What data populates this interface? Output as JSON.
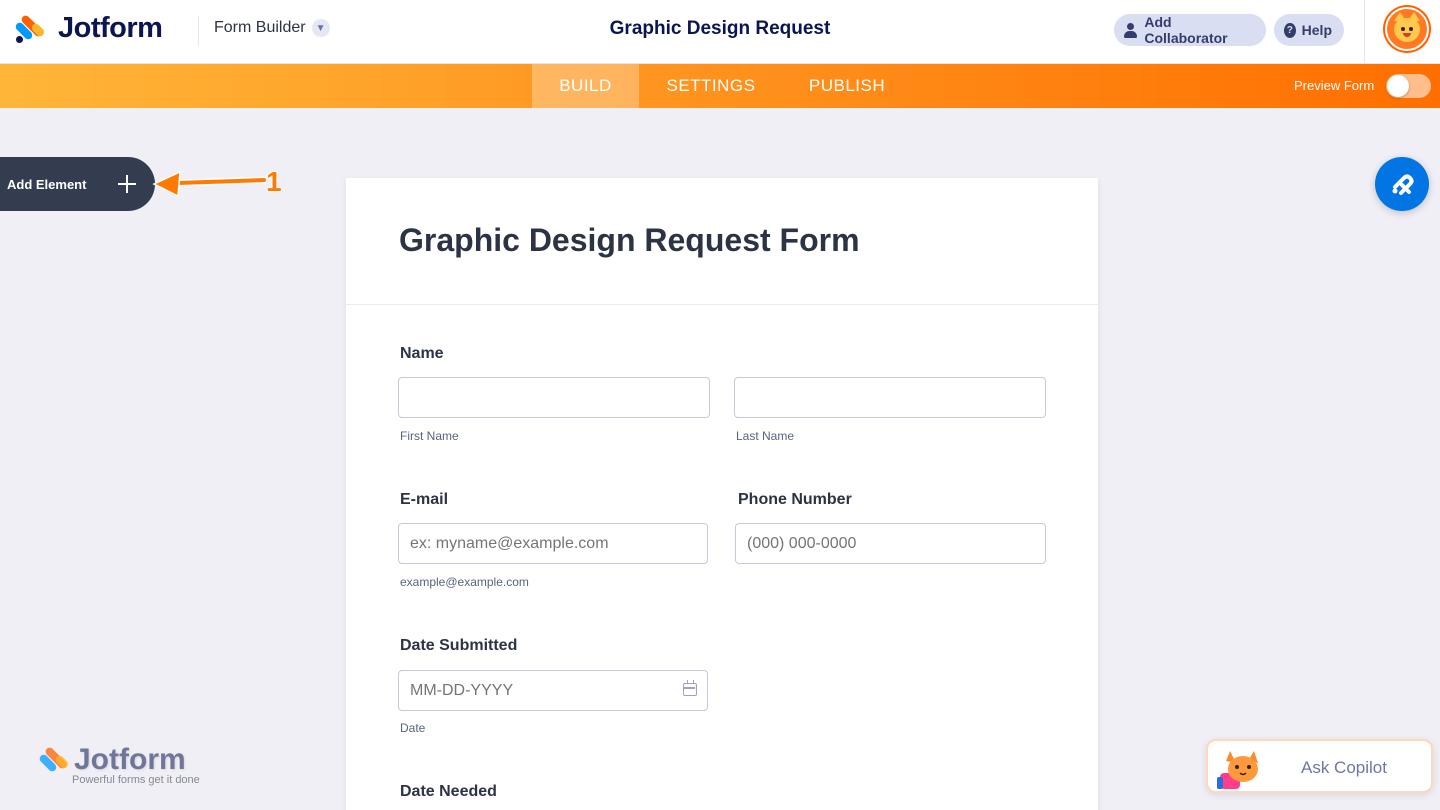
{
  "header": {
    "brand": "Jotform",
    "builder_menu": "Form Builder",
    "form_title": "Graphic Design Request",
    "add_collaborator": "Add Collaborator",
    "help": "Help"
  },
  "nav": {
    "tabs": [
      "BUILD",
      "SETTINGS",
      "PUBLISH"
    ],
    "active_tab": "BUILD",
    "preview_label": "Preview Form",
    "preview_on": false
  },
  "sidebar": {
    "add_element": "Add Element"
  },
  "annotation": {
    "number": "1"
  },
  "form": {
    "heading": "Graphic Design Request Form",
    "name": {
      "label": "Name",
      "first_sublabel": "First Name",
      "last_sublabel": "Last Name"
    },
    "email": {
      "label": "E-mail",
      "placeholder": "ex: myname@example.com",
      "sublabel": "example@example.com"
    },
    "phone": {
      "label": "Phone Number",
      "placeholder": "(000) 000-0000"
    },
    "date_submitted": {
      "label": "Date Submitted",
      "placeholder": "MM-DD-YYYY",
      "sublabel": "Date"
    },
    "date_needed": {
      "label": "Date Needed"
    }
  },
  "watermark": {
    "brand": "Jotform",
    "tagline": "Powerful forms get it done"
  },
  "copilot": {
    "label": "Ask Copilot"
  },
  "colors": {
    "brand_navy": "#0a1551",
    "nav_orange_start": "#ffb638",
    "nav_orange_end": "#ff6f00",
    "theme_button_blue": "#0075e3",
    "add_element_bg": "#343c4f"
  }
}
